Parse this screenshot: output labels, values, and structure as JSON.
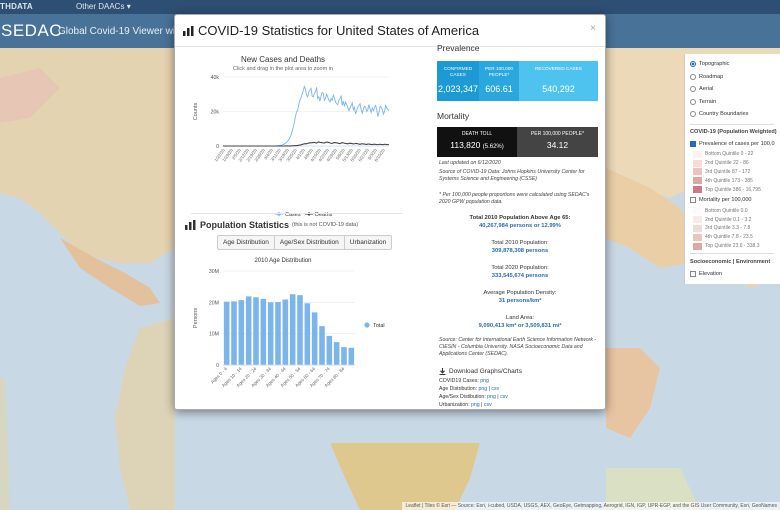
{
  "topnav": {
    "brand": "EARTHDATA",
    "brand_visible": "THDATA",
    "daacs": "Other DAACs",
    "daacs_caret": "▾"
  },
  "appbar": {
    "logo": "SEDAC",
    "title": "Global Covid-19 Viewer with"
  },
  "map": {
    "attribution": "Leaflet | Tiles © Esri — Source: Esri, i-cubed, USDA, USGS, AEX, GeoEye, Getmapping, Aerogrid, IGN, IGP, UPR-EGP, and the GIS User Community, Esri, GeoNames"
  },
  "layers": {
    "basemaps": [
      "Topographic",
      "Roadmap",
      "Aerial",
      "Terrain",
      "Country Boundaries"
    ],
    "selected_basemap": "Topographic",
    "covid_header": "COVID-19 (Population Weighted)",
    "prevalence_label": "Prevalence of cases per 100,0",
    "prevalence_checked": true,
    "prevalence_legend": [
      {
        "label": "Bottom Quintile 0 - 22",
        "color": "#fdf2ee"
      },
      {
        "label": "2nd Quintile 22 - 86",
        "color": "#f8dcd3"
      },
      {
        "label": "3rd Quintile 87 - 172",
        "color": "#f0c1b8"
      },
      {
        "label": "4th Quintile 173 - 385",
        "color": "#e2a6a0"
      },
      {
        "label": "Top Quintile 386 - 16,795",
        "color": "#cc7a86"
      }
    ],
    "mortality_label": "Mortality per 100,000",
    "mortality_checked": false,
    "mortality_legend": [
      {
        "label": "Bottom Quintile 0.0",
        "color": "#fbfbfb"
      },
      {
        "label": "2nd Quintile 0.1 - 3.2",
        "color": "#f6ece9"
      },
      {
        "label": "3rd Quintile 3.3 - 7.8",
        "color": "#f0dbd6"
      },
      {
        "label": "4th Quintile 7.8 - 23.5",
        "color": "#e9c7c1"
      },
      {
        "label": "Top Quintile 23.6 - 338.3",
        "color": "#dcaaa4"
      }
    ],
    "socio_header": "Socioeconomic | Environment",
    "elevation_label": "Elevation"
  },
  "modal": {
    "title": "COVID-19 Statistics for United States of America",
    "close": "×",
    "cases_chart": {
      "title": "New Cases and Deaths",
      "subtitle": "Click and drag in the plot area to zoom in",
      "ylabel": "Counts",
      "yticks": [
        "0",
        "20k",
        "40k"
      ],
      "xticks": [
        "1/22/20",
        "1/29/20",
        "2/5/20",
        "2/12/20",
        "2/19/20",
        "2/26/20",
        "3/4/20",
        "3/11/20",
        "3/18/20",
        "3/25/20",
        "4/1/20",
        "4/8/20",
        "4/15/20",
        "4/22/20",
        "4/29/20",
        "5/6/20",
        "5/13/20",
        "5/20/20",
        "5/27/20",
        "6/3/20",
        "6/10/20"
      ],
      "legend_cases": "Cases",
      "legend_deaths": "Deaths"
    },
    "population": {
      "heading": "Population Statistics",
      "note": "(this is not COVID-19 data)",
      "buttons": [
        "Age Distribution",
        "Age/Sex Distribution",
        "Urbanization"
      ],
      "chart_title": "2010 Age Distribution",
      "ylabel": "Persons",
      "yticks": [
        "0",
        "10M",
        "20M",
        "30M"
      ],
      "legend": "Total"
    },
    "prevalence": {
      "heading": "Prevalence",
      "confirmed_label": "Confirmed cases",
      "confirmed_value": "2,023,347",
      "per100k_label": "Per 100,000 people*",
      "per100k_value": "606.61",
      "recovered_label": "Recovered cases",
      "recovered_value": "540,292"
    },
    "mortality": {
      "heading": "Mortality",
      "death_label": "Death Toll",
      "death_value": "113,820",
      "death_pct": "(5.62%)",
      "per100k_label": "Per 100,000 people*",
      "per100k_value": "34.12"
    },
    "updated": "Last updated on 6/12/2020",
    "source_covid": "Source of COVID-19 Data: Johns Hopkins University Center for Systems Science and Engineering (CSSE)",
    "footnote": "* Per 100,000 people proportions were calculated using SEDAC's 2020 GPW population data.",
    "stats": {
      "above65_label": "Total 2010 Population Above Age 65:",
      "above65_value": "40,267,984 persons or 12.99%",
      "pop2010_label": "Total 2010 Population:",
      "pop2010_value": "309,878,308 persons",
      "pop2020_label": "Total 2020 Population:",
      "pop2020_value": "333,545,674 persons",
      "density_label": "Average Population Density:",
      "density_value": "31 persons/km²",
      "area_label": "Land Area:",
      "area_value": "9,090,413 km² or 3,509,831 mi²"
    },
    "source_pop": "Source: Center for International Earth Science Information Network - CIESIN - Columbia University. NASA Socioeconomic Data and Applications Center (SEDAC).",
    "downloads": {
      "heading": "Download Graphs/Charts",
      "rows": [
        {
          "label": "COVID19 Cases:",
          "links": [
            "png"
          ]
        },
        {
          "label": "Age Distribution:",
          "links": [
            "png",
            "csv"
          ]
        },
        {
          "label": "Age/Sex Distibution:",
          "links": [
            "png",
            "csv"
          ]
        },
        {
          "label": "Urbanization:",
          "links": [
            "png",
            "csv"
          ]
        }
      ]
    }
  },
  "chart_data": [
    {
      "type": "line",
      "title": "New Cases and Deaths",
      "ylabel": "Counts",
      "ylim": [
        0,
        40000
      ],
      "x_start": "1/22/20",
      "x_end": "6/12/20",
      "series": [
        {
          "name": "Cases",
          "color": "#7cb5ec",
          "values": [
            1,
            0,
            1,
            0,
            2,
            0,
            0,
            1,
            0,
            2,
            1,
            0,
            0,
            0,
            1,
            0,
            0,
            0,
            0,
            0,
            0,
            0,
            0,
            0,
            0,
            0,
            0,
            0,
            1,
            0,
            0,
            0,
            0,
            0,
            0,
            0,
            1,
            0,
            0,
            1,
            2,
            5,
            8,
            10,
            20,
            35,
            40,
            60,
            120,
            180,
            250,
            350,
            450,
            600,
            800,
            1200,
            1600,
            2200,
            2800,
            3500,
            4800,
            6200,
            8500,
            10800,
            13500,
            17000,
            19800,
            20500,
            24000,
            26500,
            28000,
            30000,
            32000,
            34500,
            33000,
            29500,
            28500,
            31500,
            32500,
            33500,
            29000,
            28500,
            30500,
            31500,
            34000,
            27500,
            28500,
            26000,
            29000,
            31000,
            30500,
            26500,
            27500,
            30000,
            28500,
            26500,
            25500,
            27500,
            26500,
            29500,
            28000,
            25500,
            24500,
            24000,
            26500,
            27500,
            29000,
            23500,
            26000,
            23000,
            25500,
            24000,
            22500,
            20500,
            22000,
            23500,
            25000,
            21000,
            22500,
            18500,
            20500,
            22500,
            23500,
            24500,
            21000,
            19000,
            21500,
            23000,
            22500,
            20000,
            21000,
            24000,
            21500,
            19500,
            22000,
            20500,
            22500,
            23500,
            21000,
            17000,
            19500,
            23000,
            22500,
            21000,
            18500,
            20000,
            23500,
            22000,
            21000,
            20500
          ],
          "note": "daily new cases, 1/22/20 - 6/12/20"
        },
        {
          "name": "Deaths",
          "color": "#434348",
          "values": [
            0,
            0,
            0,
            0,
            0,
            0,
            0,
            0,
            0,
            0,
            0,
            0,
            0,
            0,
            0,
            0,
            0,
            0,
            0,
            0,
            0,
            0,
            0,
            0,
            0,
            0,
            0,
            0,
            0,
            0,
            0,
            0,
            0,
            0,
            0,
            0,
            0,
            0,
            0,
            0,
            0,
            0,
            0,
            0,
            0,
            0,
            0,
            0,
            0,
            0,
            0,
            1,
            2,
            3,
            5,
            8,
            10,
            15,
            20,
            30,
            45,
            60,
            90,
            120,
            180,
            220,
            280,
            350,
            450,
            550,
            700,
            900,
            1100,
            1250,
            1350,
            1300,
            1500,
            1700,
            1900,
            1800,
            1950,
            2000,
            2100,
            1900,
            1700,
            2200,
            2400,
            2100,
            2000,
            1900,
            1800,
            1700,
            2100,
            2300,
            2200,
            2000,
            1800,
            1600,
            1500,
            1900,
            2000,
            1900,
            1800,
            1700,
            1500,
            1400,
            1700,
            1900,
            1800,
            1600,
            1500,
            1400,
            1300,
            1500,
            1600,
            1500,
            1400,
            1200,
            1300,
            1500,
            1400,
            1300,
            1100,
            1000,
            1200,
            1300,
            1200,
            1100,
            950,
            900,
            1100,
            1100,
            1000,
            900,
            800,
            1000,
            1050,
            950,
            850,
            800,
            950,
            1000,
            900,
            850,
            800,
            1000,
            950,
            850,
            800,
            900
          ]
        }
      ],
      "xticks": [
        "1/22/20",
        "1/29/20",
        "2/5/20",
        "2/12/20",
        "2/19/20",
        "2/26/20",
        "3/4/20",
        "3/11/20",
        "3/18/20",
        "3/25/20",
        "4/1/20",
        "4/8/20",
        "4/15/20",
        "4/22/20",
        "4/29/20",
        "5/6/20",
        "5/13/20",
        "5/20/20",
        "5/27/20",
        "6/3/20",
        "6/10/20"
      ],
      "legend": "bottom"
    },
    {
      "type": "bar",
      "title": "2010 Age Distribution",
      "ylabel": "Persons",
      "ylim": [
        0,
        30000000
      ],
      "categories": [
        "Ages 0 - 4",
        "Ages 5 - 9",
        "Ages 10 - 14",
        "Ages 15 - 19",
        "Ages 20 - 24",
        "Ages 25 - 29",
        "Ages 30 - 34",
        "Ages 35 - 39",
        "Ages 40 - 44",
        "Ages 45 - 49",
        "Ages 50 - 54",
        "Ages 55 - 59",
        "Ages 60 - 64",
        "Ages 65 - 69",
        "Ages 70 - 74",
        "Ages 75 - 79",
        "Ages 80 - 84",
        "Ages 85+"
      ],
      "tick_labels": [
        "Ages 0 - 4",
        "Ages 10 - 14",
        "Ages 20 - 24",
        "Ages 30 - 34",
        "Ages 40 - 44",
        "Ages 50 - 54",
        "Ages 60 - 64",
        "Ages 70 - 74",
        "Ages 80 - 84"
      ],
      "series": [
        {
          "name": "Total",
          "color": "#7cb5ec",
          "values": [
            20200000,
            20300000,
            20700000,
            21900000,
            21600000,
            21100000,
            20000000,
            20100000,
            20900000,
            22600000,
            22300000,
            19700000,
            16800000,
            12400000,
            9300000,
            7300000,
            5700000,
            5500000
          ]
        }
      ],
      "legend": "right"
    }
  ]
}
